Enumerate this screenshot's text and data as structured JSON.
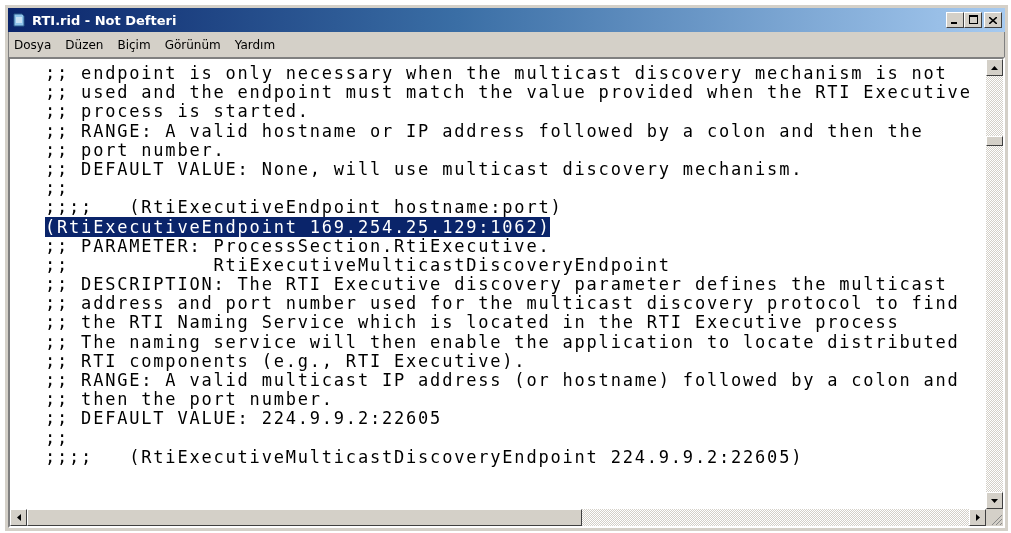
{
  "window": {
    "title": "RTI.rid - Not Defteri"
  },
  "menu": [
    {
      "label": "Dosya"
    },
    {
      "label": "Düzen"
    },
    {
      "label": "Biçim"
    },
    {
      "label": "Görünüm"
    },
    {
      "label": "Yardım"
    }
  ],
  "editor": {
    "lines": [
      {
        "text": ";; endpoint is only necessary when the multicast discovery mechanism is not",
        "selected": false
      },
      {
        "text": ";; used and the endpoint must match the value provided when the RTI Executive",
        "selected": false
      },
      {
        "text": ";; process is started.",
        "selected": false
      },
      {
        "text": ";; RANGE: A valid hostname or IP address followed by a colon and then the",
        "selected": false
      },
      {
        "text": ";; port number.",
        "selected": false
      },
      {
        "text": ";; DEFAULT VALUE: None, will use multicast discovery mechanism.",
        "selected": false
      },
      {
        "text": ";;",
        "selected": false
      },
      {
        "text": ";;;;   (RtiExecutiveEndpoint hostname:port)",
        "selected": false
      },
      {
        "text": "(RtiExecutiveEndpoint 169.254.25.129:1062)",
        "selected": true
      },
      {
        "text": ";; PARAMETER: ProcessSection.RtiExecutive.",
        "selected": false
      },
      {
        "text": ";;            RtiExecutiveMulticastDiscoveryEndpoint",
        "selected": false
      },
      {
        "text": ";; DESCRIPTION: The RTI Executive discovery parameter defines the multicast",
        "selected": false
      },
      {
        "text": ";; address and port number used for the multicast discovery protocol to find",
        "selected": false
      },
      {
        "text": ";; the RTI Naming Service which is located in the RTI Executive process",
        "selected": false
      },
      {
        "text": ";; The naming service will then enable the application to locate distributed",
        "selected": false
      },
      {
        "text": ";; RTI components (e.g., RTI Executive).",
        "selected": false
      },
      {
        "text": ";; RANGE: A valid multicast IP address (or hostname) followed by a colon and",
        "selected": false
      },
      {
        "text": ";; then the port number.",
        "selected": false
      },
      {
        "text": ";; DEFAULT VALUE: 224.9.9.2:22605",
        "selected": false
      },
      {
        "text": ";;",
        "selected": false
      },
      {
        "text": ";;;;   (RtiExecutiveMulticastDiscoveryEndpoint 224.9.9.2:22605)",
        "selected": false
      }
    ]
  }
}
